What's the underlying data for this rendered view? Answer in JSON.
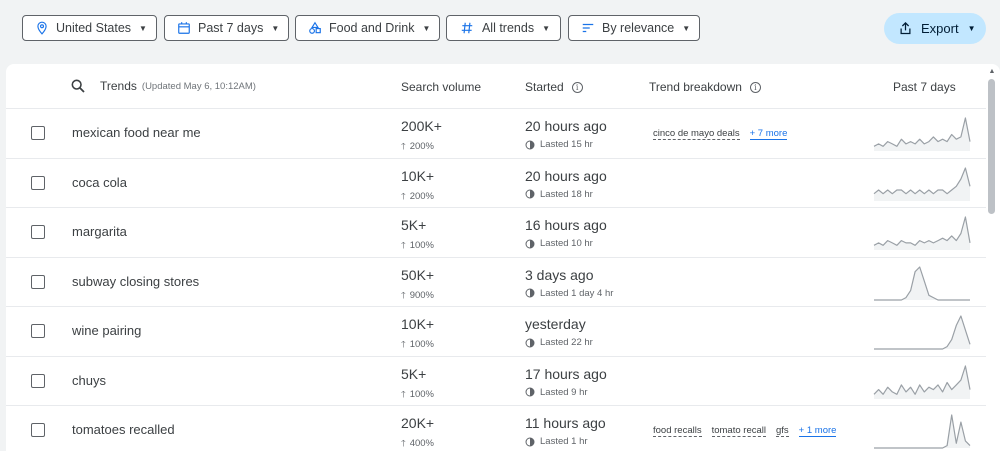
{
  "filters": {
    "location": "United States",
    "time": "Past 7 days",
    "category": "Food and Drink",
    "trends": "All trends",
    "sort": "By relevance"
  },
  "export_label": "Export",
  "header": {
    "trends": "Trends",
    "updated": "(Updated May 6, 10:12AM)",
    "search_volume": "Search volume",
    "started": "Started",
    "trend_breakdown": "Trend breakdown",
    "past_days": "Past 7 days"
  },
  "rows": [
    {
      "name": "mexican food near me",
      "volume": "200K+",
      "pct": "200%",
      "started": "20 hours ago",
      "lasted": "Lasted 15 hr",
      "breakdown": [
        "cinco de mayo deals"
      ],
      "more": "+ 7 more",
      "spark": [
        2,
        3,
        2,
        4,
        3,
        2,
        5,
        3,
        4,
        3,
        5,
        3,
        4,
        6,
        4,
        5,
        4,
        7,
        5,
        6,
        14,
        4
      ]
    },
    {
      "name": "coca cola",
      "volume": "10K+",
      "pct": "200%",
      "started": "20 hours ago",
      "lasted": "Lasted 18 hr",
      "breakdown": [],
      "more": "",
      "spark": [
        2,
        3,
        2,
        3,
        2,
        3,
        3,
        2,
        3,
        2,
        3,
        2,
        3,
        2,
        3,
        3,
        2,
        3,
        4,
        6,
        9,
        4
      ]
    },
    {
      "name": "margarita",
      "volume": "5K+",
      "pct": "100%",
      "started": "16 hours ago",
      "lasted": "Lasted 10 hr",
      "breakdown": [],
      "more": "",
      "spark": [
        2,
        3,
        2,
        4,
        3,
        2,
        4,
        3,
        3,
        2,
        4,
        3,
        4,
        3,
        4,
        5,
        4,
        6,
        4,
        7,
        14,
        3
      ]
    },
    {
      "name": "subway closing stores",
      "volume": "50K+",
      "pct": "900%",
      "started": "3 days ago",
      "lasted": "Lasted 1 day 4 hr",
      "breakdown": [],
      "more": "",
      "spark": [
        0,
        0,
        0,
        0,
        0,
        0,
        0,
        1,
        4,
        12,
        14,
        8,
        2,
        1,
        0,
        0,
        0,
        0,
        0,
        0,
        0,
        0
      ]
    },
    {
      "name": "wine pairing",
      "volume": "10K+",
      "pct": "100%",
      "started": "yesterday",
      "lasted": "Lasted 22 hr",
      "breakdown": [],
      "more": "",
      "spark": [
        0,
        0,
        0,
        0,
        0,
        0,
        0,
        0,
        0,
        0,
        0,
        0,
        0,
        0,
        0,
        0,
        1,
        4,
        10,
        14,
        8,
        2
      ]
    },
    {
      "name": "chuys",
      "volume": "5K+",
      "pct": "100%",
      "started": "17 hours ago",
      "lasted": "Lasted 9 hr",
      "breakdown": [],
      "more": "",
      "spark": [
        2,
        4,
        2,
        5,
        3,
        2,
        6,
        3,
        5,
        2,
        6,
        3,
        5,
        4,
        6,
        3,
        7,
        4,
        6,
        8,
        14,
        4
      ]
    },
    {
      "name": "tomatoes recalled",
      "volume": "20K+",
      "pct": "400%",
      "started": "11 hours ago",
      "lasted": "Lasted 1 hr",
      "breakdown": [
        "food recalls",
        "tomato recall",
        "gfs"
      ],
      "more": "+ 1 more",
      "spark": [
        0,
        0,
        0,
        0,
        0,
        0,
        0,
        0,
        0,
        0,
        0,
        0,
        0,
        0,
        0,
        0,
        1,
        14,
        2,
        11,
        3,
        1
      ]
    }
  ]
}
